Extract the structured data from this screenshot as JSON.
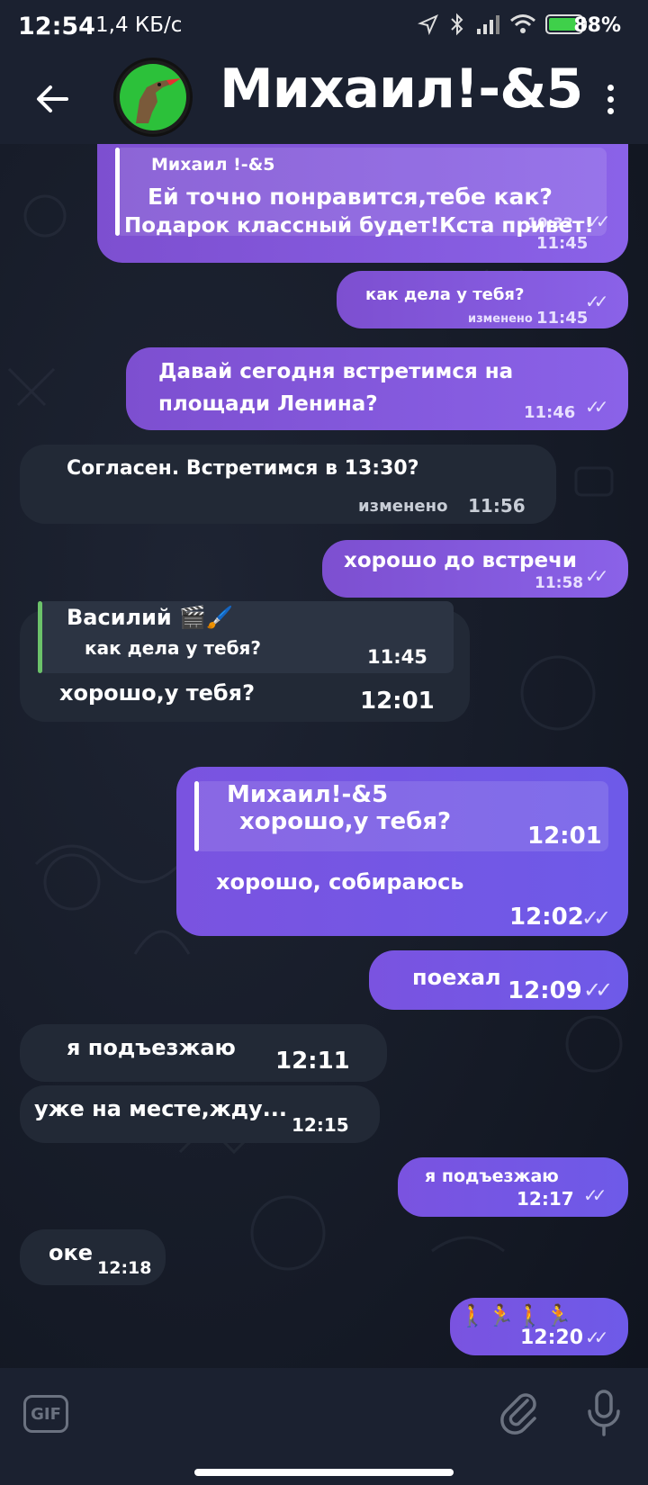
{
  "status": {
    "time": "12:54",
    "network": "1,4 КБ/с",
    "battery": "88%",
    "battery_level": 0.88
  },
  "header": {
    "title": "Михаил!-&5"
  },
  "messages": {
    "m1": {
      "quote_author": "Михаил !-&5",
      "quote_text": "Ей точно понравится,тебе как?",
      "quote_time": "10:32",
      "text": "Подарок классный будет!Кста привет!",
      "time": "11:45"
    },
    "m2": {
      "text": "как дела у тебя?",
      "edited": "изменено",
      "time": "11:45"
    },
    "m3": {
      "line1": "Давай сегодня встретимся на",
      "line2": "площади Ленина?",
      "time": "11:46"
    },
    "m4": {
      "text": "Согласен. Встретимся в 13:30?",
      "edited": "изменено",
      "time": "11:56"
    },
    "m5": {
      "text": "хорошо до встречи",
      "time": "11:58"
    },
    "m6": {
      "quote_author": "Василий 🎬🖌️",
      "quote_text": "как дела у тебя?",
      "quote_time": "11:45",
      "text": "хорошо,у тебя?",
      "time": "12:01"
    },
    "m7": {
      "quote_author": "Михаил!-&5",
      "quote_text": "хорошо,у тебя?",
      "quote_time": "12:01",
      "text": "хорошо, собираюсь",
      "time": "12:02"
    },
    "m8": {
      "text": "поехал",
      "time": "12:09"
    },
    "m9": {
      "text": "я подъезжаю",
      "time": "12:11"
    },
    "m10": {
      "text": "уже на месте,жду...",
      "time": "12:15"
    },
    "m11": {
      "text": "я подъезжаю",
      "time": "12:17"
    },
    "m12": {
      "text": "оке",
      "time": "12:18"
    },
    "m13": {
      "text": "🚶🏃🚶🏃",
      "time": "12:20"
    }
  },
  "input": {
    "gif_label": "GIF"
  },
  "icons": [
    "back-arrow-icon",
    "avatar-dinosaur-icon",
    "more-vert-icon",
    "read-ticks-icon",
    "gif-icon",
    "paperclip-icon",
    "microphone-icon"
  ]
}
